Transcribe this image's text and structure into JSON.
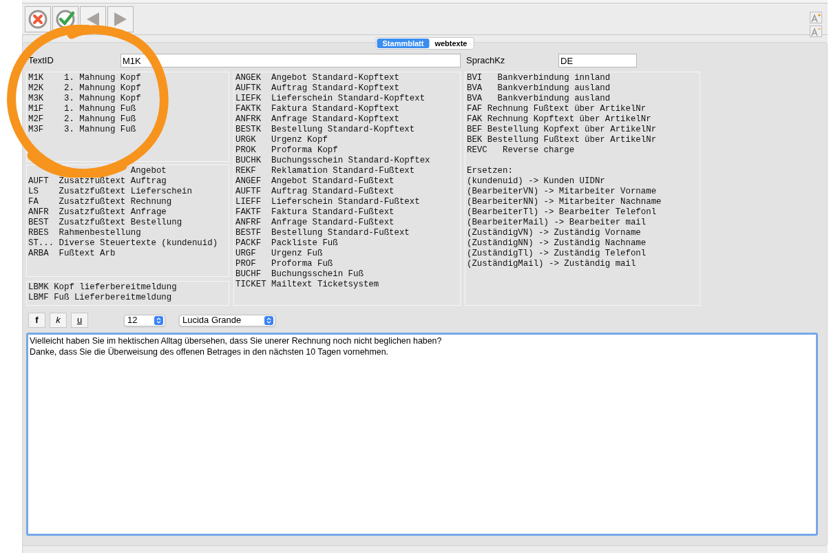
{
  "toolbar": {
    "buttons": [
      {
        "kind": "cancel"
      },
      {
        "kind": "confirm"
      },
      {
        "kind": "previous"
      },
      {
        "kind": "next"
      }
    ],
    "font_size_buttons": [
      {
        "kind": "increase"
      },
      {
        "kind": "decrease"
      }
    ]
  },
  "tabs": [
    {
      "label": "Stammblatt",
      "selected": true
    },
    {
      "label": "webtexte",
      "selected": false
    }
  ],
  "fields": [
    {
      "label": "TextID",
      "value": "M1K"
    },
    {
      "label": "SprachKz",
      "value": "DE"
    }
  ],
  "panels": [
    {
      "lines": [
        "M1K    1. Mahnung Kopf",
        "M2K    2. Mahnung Kopf",
        "M3K    3. Mahnung Kopf",
        "M1F    1. Mahnung Fuß",
        "M2F    2. Mahnung Fuß",
        "M3F    3. Mahnung Fuß"
      ]
    },
    {
      "lines": [
        "                    Angebot",
        "AUFT  Zusatzfußtext Auftrag",
        "LS    Zusatzfußtext Lieferschein",
        "FA    Zusatzfußtext Rechnung",
        "ANFR  Zusatzfußtext Anfrage",
        "BEST  Zusatzfußtext Bestellung",
        "RBES  Rahmenbestellung",
        "ST... Diverse Steuertexte (kundenuid)",
        "ARBA  Fußtext Arb"
      ]
    },
    {
      "lines": [
        "LBMK Kopf lieferbereitmeldung",
        "LBMF Fuß Lieferbereitmeldung"
      ]
    },
    {
      "lines": [
        "ANGEK  Angebot Standard-Kopftext",
        "AUFTK  Auftrag Standard-Kopftext",
        "LIEFK  Lieferschein Standard-Kopftext",
        "FAKTK  Faktura Standard-Kopftext",
        "ANFRK  Anfrage Standard-Kopftext",
        "BESTK  Bestellung Standard-Kopftext",
        "URGK   Urgenz Kopf",
        "PROK   Proforma Kopf",
        "BUCHK  Buchungsschein Standard-Kopftex",
        "REKF   Reklamation Standard-Fußtext",
        "ANGEF  Angebot Standard-Fußtext",
        "AUFTF  Auftrag Standard-Fußtext",
        "LIEFF  Lieferschein Standard-Fußtext",
        "FAKTF  Faktura Standard-Fußtext",
        "ANFRF  Anfrage Standard-Fußtext",
        "BESTF  Bestellung Standard-Fußtext",
        "PACKF  Packliste Fuß",
        "URGF   Urgenz Fuß",
        "PROF   Proforma Fuß",
        "BUCHF  Buchungsschein Fuß",
        "TICKET Mailtext Ticketsystem"
      ]
    },
    {
      "lines": [
        "BVI   Bankverbindung innland",
        "BVA   Bankverbindung ausland",
        "BVA   Bankverbindung ausland",
        "FAF Rechnung Fußtext über ArtikelNr",
        "FAK Rechnung Kopftext über ArtikelNr",
        "BEF Bestellung Kopfext über ArtikelNr",
        "BEK Bestellung Fußtext über ArtikelNr",
        "REVC   Reverse charge"
      ],
      "lines_after_gap": [
        "Ersetzen:",
        "(kundenuid) -> Kunden UIDNr",
        "(BearbeiterVN) -> Mitarbeiter Vorname",
        "(BearbeiterNN) -> Mitarbeiter Nachname",
        "(BearbeiterTl) -> Bearbeiter Telefonl",
        "(BearbeiterMail) -> Bearbeiter mail",
        "(ZuständigVN) -> Zuständig Vorname",
        "(ZuständigNN) -> Zuständig Nachname",
        "(ZuständigTl) -> Zuständig Telefonl",
        "(ZuständigMail) -> Zuständig mail"
      ]
    }
  ],
  "format_buttons": [
    "f",
    "k",
    "u"
  ],
  "size_select": {
    "value": "12"
  },
  "font_select": {
    "value": "Lucida Grande"
  },
  "editor": {
    "lines": [
      "Vielleicht haben Sie im hektischen Alltag übersehen, dass Sie unerer Rechnung noch nicht beglichen haben?",
      "Danke, dass Sie die Überweisung des offenen Betrages in den nächsten 10 Tagen vornehmen."
    ]
  },
  "annotation": {
    "kind": "circle"
  }
}
